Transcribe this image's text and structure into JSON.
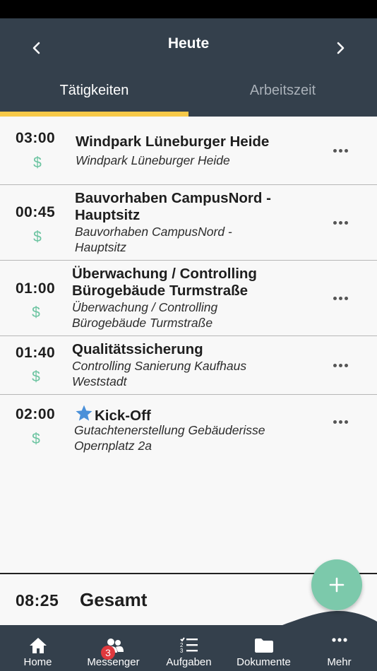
{
  "header": {
    "title": "Heute",
    "prev_icon": "chevron-left-icon",
    "next_icon": "chevron-right-icon"
  },
  "tabs": [
    {
      "label": "Tätigkeiten",
      "active": true
    },
    {
      "label": "Arbeitszeit",
      "active": false
    }
  ],
  "entries": [
    {
      "time": "03:00",
      "billable_icon": "dollar-icon",
      "title": [
        "Windpark Lüneburger Heide"
      ],
      "subtitle": [
        "Windpark Lüneburger Heide"
      ],
      "starred": false
    },
    {
      "time": "00:45",
      "billable_icon": "dollar-icon",
      "title": [
        "Bauvorhaben CampusNord -",
        "Hauptsitz"
      ],
      "subtitle": [
        "Bauvorhaben CampusNord -",
        "Hauptsitz"
      ],
      "starred": false
    },
    {
      "time": "01:00",
      "billable_icon": "dollar-icon",
      "title": [
        "Überwachung / Controlling",
        "Bürogebäude Turmstraße"
      ],
      "subtitle": [
        "Überwachung / Controlling",
        "Bürogebäude Turmstraße"
      ],
      "starred": false
    },
    {
      "time": "01:40",
      "billable_icon": "dollar-icon",
      "title": [
        "Qualitätssicherung"
      ],
      "subtitle": [
        "Controlling Sanierung Kaufhaus",
        "Weststadt"
      ],
      "starred": false
    },
    {
      "time": "02:00",
      "billable_icon": "dollar-icon",
      "title": [
        "Kick-Off"
      ],
      "subtitle": [
        "Gutachtenerstellung Gebäuderisse",
        "Opernplatz 2a"
      ],
      "starred": true
    }
  ],
  "dollar_symbol": "$",
  "total": {
    "time": "08:25",
    "label": "Gesamt"
  },
  "fab_icon": "plus-icon",
  "bottom_nav": [
    {
      "label": "Home",
      "icon": "home-icon"
    },
    {
      "label": "Messenger",
      "icon": "people-icon",
      "badge": "3"
    },
    {
      "label": "Aufgaben",
      "icon": "task-list-icon"
    },
    {
      "label": "Dokumente",
      "icon": "folder-icon"
    },
    {
      "label": "Mehr",
      "icon": "more-dots-icon"
    }
  ],
  "colors": {
    "header_bg": "#34404c",
    "tab_indicator": "#f7c948",
    "accent_green": "#7cc9ab",
    "star_blue": "#4a90d9",
    "badge_red": "#e0393e"
  }
}
